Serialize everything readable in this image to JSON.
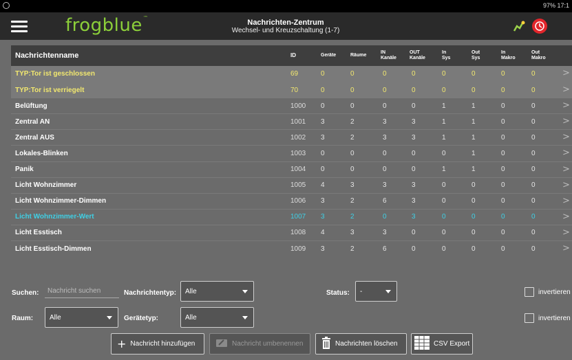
{
  "statusbar": {
    "right_text": "97% 17:1"
  },
  "header": {
    "logo": "frogblue",
    "logo_tm": "™",
    "title": "Nachrichten-Zentrum",
    "subtitle": "Wechsel- und Kreuzschaltung (1-7)"
  },
  "table": {
    "headers": {
      "name": "Nachrichtenname",
      "id": "ID",
      "geraete": "Geräte",
      "raeume": "Räume",
      "in_kanaele": "IN Kanäle",
      "out_kanaele": "OUT Kanäle",
      "in_sys": "In Sys",
      "out_sys": "Out Sys",
      "in_makro": "In Makro",
      "out_makro": "Out Makro"
    },
    "rows": [
      {
        "name": "TYP:Tor ist geschlossen",
        "id": "69",
        "geraete": "0",
        "raeume": "0",
        "in_kanaele": "0",
        "out_kanaele": "0",
        "in_sys": "0",
        "out_sys": "0",
        "in_makro": "0",
        "out_makro": "0",
        "style": "yellow"
      },
      {
        "name": "TYP:Tor ist verriegelt",
        "id": "70",
        "geraete": "0",
        "raeume": "0",
        "in_kanaele": "0",
        "out_kanaele": "0",
        "in_sys": "0",
        "out_sys": "0",
        "in_makro": "0",
        "out_makro": "0",
        "style": "yellow"
      },
      {
        "name": "Belüftung",
        "id": "1000",
        "geraete": "0",
        "raeume": "0",
        "in_kanaele": "0",
        "out_kanaele": "0",
        "in_sys": "1",
        "out_sys": "1",
        "in_makro": "0",
        "out_makro": "0",
        "style": "normal"
      },
      {
        "name": "Zentral AN",
        "id": "1001",
        "geraete": "3",
        "raeume": "2",
        "in_kanaele": "3",
        "out_kanaele": "3",
        "in_sys": "1",
        "out_sys": "1",
        "in_makro": "0",
        "out_makro": "0",
        "style": "normal"
      },
      {
        "name": "Zentral AUS",
        "id": "1002",
        "geraete": "3",
        "raeume": "2",
        "in_kanaele": "3",
        "out_kanaele": "3",
        "in_sys": "1",
        "out_sys": "1",
        "in_makro": "0",
        "out_makro": "0",
        "style": "normal"
      },
      {
        "name": "Lokales-Blinken",
        "id": "1003",
        "geraete": "0",
        "raeume": "0",
        "in_kanaele": "0",
        "out_kanaele": "0",
        "in_sys": "0",
        "out_sys": "1",
        "in_makro": "0",
        "out_makro": "0",
        "style": "normal"
      },
      {
        "name": "Panik",
        "id": "1004",
        "geraete": "0",
        "raeume": "0",
        "in_kanaele": "0",
        "out_kanaele": "0",
        "in_sys": "1",
        "out_sys": "1",
        "in_makro": "0",
        "out_makro": "0",
        "style": "normal"
      },
      {
        "name": "Licht Wohnzimmer",
        "id": "1005",
        "geraete": "4",
        "raeume": "3",
        "in_kanaele": "3",
        "out_kanaele": "3",
        "in_sys": "0",
        "out_sys": "0",
        "in_makro": "0",
        "out_makro": "0",
        "style": "normal"
      },
      {
        "name": "Licht Wohnzimmer-Dimmen",
        "id": "1006",
        "geraete": "3",
        "raeume": "2",
        "in_kanaele": "6",
        "out_kanaele": "3",
        "in_sys": "0",
        "out_sys": "0",
        "in_makro": "0",
        "out_makro": "0",
        "style": "normal"
      },
      {
        "name": "Licht Wohnzimmer-Wert",
        "id": "1007",
        "geraete": "3",
        "raeume": "2",
        "in_kanaele": "0",
        "out_kanaele": "3",
        "in_sys": "0",
        "out_sys": "0",
        "in_makro": "0",
        "out_makro": "0",
        "style": "cyan"
      },
      {
        "name": "Licht Esstisch",
        "id": "1008",
        "geraete": "4",
        "raeume": "3",
        "in_kanaele": "3",
        "out_kanaele": "0",
        "in_sys": "0",
        "out_sys": "0",
        "in_makro": "0",
        "out_makro": "0",
        "style": "normal"
      },
      {
        "name": "Licht Esstisch-Dimmen",
        "id": "1009",
        "geraete": "3",
        "raeume": "2",
        "in_kanaele": "6",
        "out_kanaele": "0",
        "in_sys": "0",
        "out_sys": "0",
        "in_makro": "0",
        "out_makro": "0",
        "style": "normal"
      }
    ],
    "chevron": ">"
  },
  "filters": {
    "search_label": "Suchen:",
    "search_placeholder": "Nachricht suchen",
    "nachrichtentyp_label": "Nachrichtentyp:",
    "nachrichtentyp_value": "Alle",
    "status_label": "Status:",
    "status_value": "-",
    "invertieren_1": "invertieren",
    "raum_label": "Raum:",
    "raum_value": "Alle",
    "geraetetyp_label": "Gerätetyp:",
    "geraetetyp_value": "Alle",
    "invertieren_2": "invertieren"
  },
  "actions": {
    "add": "Nachricht hinzufügen",
    "rename": "Nachricht umbenennen",
    "delete": "Nachrichten löschen",
    "csv": "CSV Export"
  },
  "colors": {
    "accent_green": "#8ccf3a",
    "highlight_yellow": "#f2e86f",
    "highlight_cyan": "#3fd0e6",
    "alarm_red": "#e2252b"
  }
}
